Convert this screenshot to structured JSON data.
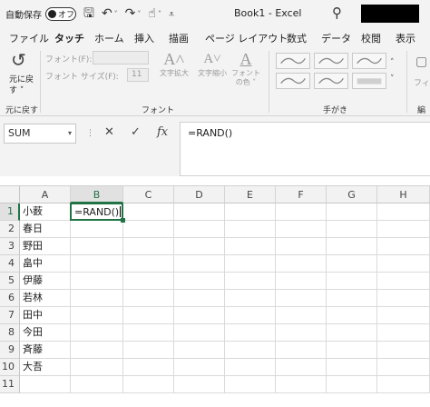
{
  "titlebar": {
    "autosave_label": "自動保存",
    "autosave_state": "オフ",
    "document_title": "Book1  -  Excel",
    "qa_icons": [
      "save-icon",
      "undo-icon",
      "redo-icon",
      "touch-mode-icon",
      "customize-icon"
    ]
  },
  "tabs": [
    {
      "label": "ファイル",
      "active": false
    },
    {
      "label": "タッチ",
      "active": true
    },
    {
      "label": "ホーム",
      "active": false
    },
    {
      "label": "挿入",
      "active": false
    },
    {
      "label": "描画",
      "active": false
    },
    {
      "label": "ページ レイアウト",
      "active": false
    },
    {
      "label": "数式",
      "active": false
    },
    {
      "label": "データ",
      "active": false
    },
    {
      "label": "校閲",
      "active": false
    },
    {
      "label": "表示",
      "active": false
    }
  ],
  "ribbon": {
    "undo_label_line1": "元に戻",
    "undo_label_line2": "す ˅",
    "group_undo": "元に戻す",
    "font_label": "フォント(F):",
    "font_size_label": "フォント サイズ(F):",
    "font_size_value": "11",
    "increase_font": "文字拡大",
    "decrease_font": "文字縮小",
    "font_color_line1": "フォント",
    "font_color_line2": "の色 ˅",
    "group_font": "フォント",
    "group_handwriting": "手がき",
    "edge_label": "フィ",
    "edge_group": "編"
  },
  "formula_bar": {
    "name_box": "SUM",
    "cancel_icon": "✕",
    "enter_icon": "✓",
    "fx_icon": "fx",
    "content": "=RAND()"
  },
  "columns": [
    "A",
    "B",
    "C",
    "D",
    "E",
    "F",
    "G",
    "H"
  ],
  "selected_column": "B",
  "rows": [
    {
      "num": "1",
      "a": "小薮",
      "b": "=RAND()"
    },
    {
      "num": "2",
      "a": "春日",
      "b": ""
    },
    {
      "num": "3",
      "a": "野田",
      "b": ""
    },
    {
      "num": "4",
      "a": "畠中",
      "b": ""
    },
    {
      "num": "5",
      "a": "伊藤",
      "b": ""
    },
    {
      "num": "6",
      "a": "若林",
      "b": ""
    },
    {
      "num": "7",
      "a": "田中",
      "b": ""
    },
    {
      "num": "8",
      "a": "今田",
      "b": ""
    },
    {
      "num": "9",
      "a": "斉藤",
      "b": ""
    },
    {
      "num": "10",
      "a": "大吾",
      "b": ""
    },
    {
      "num": "11",
      "a": "",
      "b": ""
    }
  ],
  "selected_row": "1",
  "colors": {
    "accent": "#217346",
    "chrome": "#f3f3f3"
  }
}
